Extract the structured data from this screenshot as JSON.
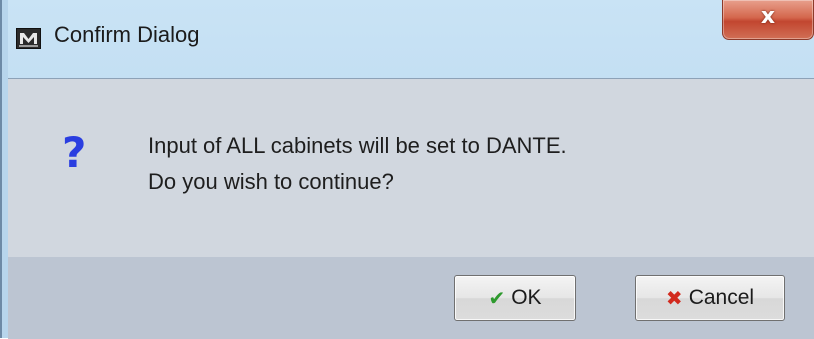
{
  "window": {
    "title": "Confirm Dialog",
    "app_icon": "vu-net-app-icon",
    "close_glyph": "x"
  },
  "message": {
    "icon": "question-icon",
    "icon_glyph": "?",
    "line1": "Input of ALL cabinets will be set to DANTE.",
    "line2": "Do you wish to continue?"
  },
  "buttons": {
    "ok": {
      "glyph": "✔",
      "icon": "checkmark-icon",
      "label": "OK",
      "glyph_color": "#2e9a2e"
    },
    "cancel": {
      "glyph": "✖",
      "icon": "cross-icon",
      "label": "Cancel",
      "glyph_color": "#d22a1e"
    }
  },
  "colors": {
    "question_mark": "#2a3ee0",
    "close_button": "#c9553b"
  }
}
